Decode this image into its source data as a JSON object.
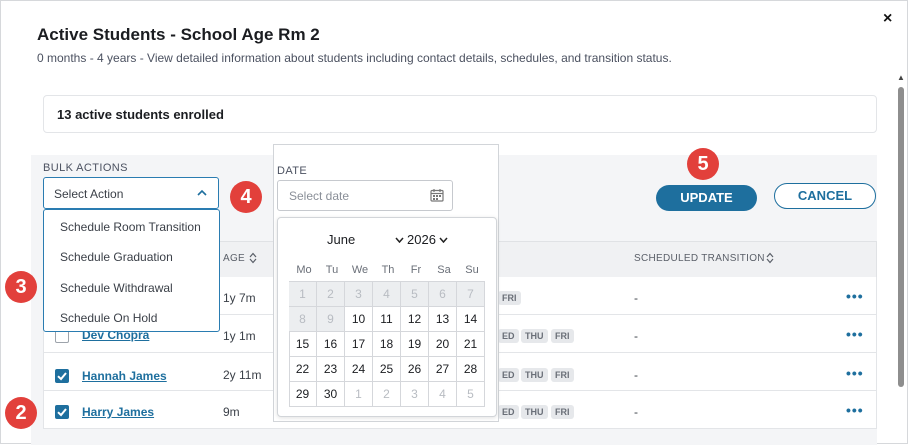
{
  "modal": {
    "title": "Active Students - School Age Rm 2",
    "subtitle": "0 months - 4 years - View detailed information about students including contact details, schedules, and transition status.",
    "close_label": "×"
  },
  "summary": {
    "text": "13 active students enrolled"
  },
  "bulk_actions": {
    "label": "BULK ACTIONS",
    "selected": "Select Action",
    "options": [
      "Schedule Room Transition",
      "Schedule Graduation",
      "Schedule Withdrawal",
      "Schedule On Hold"
    ]
  },
  "date_picker": {
    "label": "DATE",
    "placeholder": "Select date",
    "month": "June",
    "year": "2026",
    "weekdays": [
      "Mo",
      "Tu",
      "We",
      "Th",
      "Fr",
      "Sa",
      "Su"
    ],
    "weeks": [
      [
        {
          "d": "1",
          "s": "dis"
        },
        {
          "d": "2",
          "s": "dis"
        },
        {
          "d": "3",
          "s": "dis"
        },
        {
          "d": "4",
          "s": "dis"
        },
        {
          "d": "5",
          "s": "dis"
        },
        {
          "d": "6",
          "s": "dis"
        },
        {
          "d": "7",
          "s": "dis"
        }
      ],
      [
        {
          "d": "8",
          "s": "dis"
        },
        {
          "d": "9",
          "s": "dis"
        },
        {
          "d": "10",
          "s": ""
        },
        {
          "d": "11",
          "s": ""
        },
        {
          "d": "12",
          "s": ""
        },
        {
          "d": "13",
          "s": ""
        },
        {
          "d": "14",
          "s": ""
        }
      ],
      [
        {
          "d": "15",
          "s": ""
        },
        {
          "d": "16",
          "s": ""
        },
        {
          "d": "17",
          "s": ""
        },
        {
          "d": "18",
          "s": ""
        },
        {
          "d": "19",
          "s": ""
        },
        {
          "d": "20",
          "s": ""
        },
        {
          "d": "21",
          "s": ""
        }
      ],
      [
        {
          "d": "22",
          "s": ""
        },
        {
          "d": "23",
          "s": ""
        },
        {
          "d": "24",
          "s": ""
        },
        {
          "d": "25",
          "s": ""
        },
        {
          "d": "26",
          "s": ""
        },
        {
          "d": "27",
          "s": ""
        },
        {
          "d": "28",
          "s": ""
        }
      ],
      [
        {
          "d": "29",
          "s": ""
        },
        {
          "d": "30",
          "s": ""
        },
        {
          "d": "1",
          "s": "out"
        },
        {
          "d": "2",
          "s": "out"
        },
        {
          "d": "3",
          "s": "out"
        },
        {
          "d": "4",
          "s": "out"
        },
        {
          "d": "5",
          "s": "out"
        }
      ]
    ]
  },
  "actions": {
    "update": "UPDATE",
    "cancel": "CANCEL"
  },
  "table": {
    "col_age": "AGE",
    "col_transition": "SCHEDULED TRANSITION",
    "rows": [
      {
        "checked": false,
        "name": "",
        "age": "1y 7m",
        "days": [
          "FRI"
        ],
        "transition": "-"
      },
      {
        "checked": false,
        "name": "Dev Chopra",
        "age": "1y 1m",
        "days": [
          "ED",
          "THU",
          "FRI"
        ],
        "transition": "-"
      },
      {
        "checked": true,
        "name": "Hannah James",
        "age": "2y 11m",
        "days": [
          "ED",
          "THU",
          "FRI"
        ],
        "transition": "-"
      },
      {
        "checked": true,
        "name": "Harry James",
        "age": "9m",
        "days": [
          "ED",
          "THU",
          "FRI"
        ],
        "transition": "-"
      }
    ],
    "row_menu": "•••"
  },
  "callouts": [
    "2",
    "3",
    "4",
    "5"
  ],
  "colors": {
    "primary": "#1e6f9e",
    "callout": "#e2403b",
    "panel": "#f4f5f7"
  },
  "icons": {
    "close": "close-icon",
    "chevron": "chevron-up-icon",
    "calendar": "calendar-icon",
    "sort": "sort-icon",
    "check": "check-icon",
    "more": "more-horizontal-icon"
  }
}
